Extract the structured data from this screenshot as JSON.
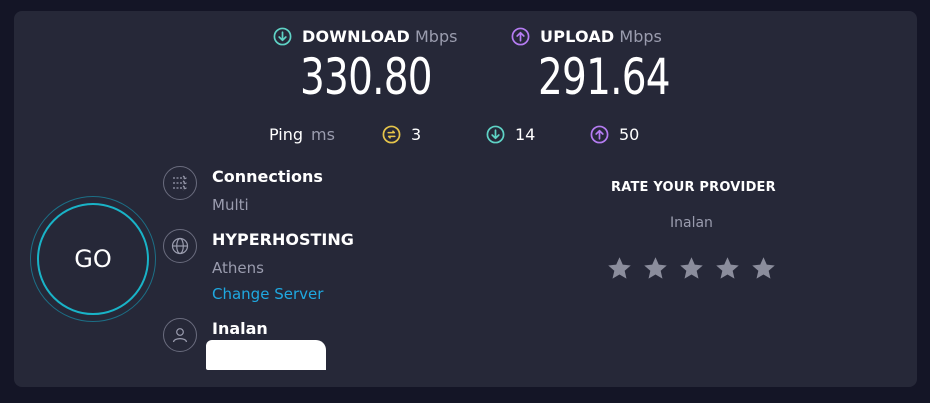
{
  "download": {
    "label": "DOWNLOAD",
    "unit": "Mbps",
    "value": "330.80"
  },
  "upload": {
    "label": "UPLOAD",
    "unit": "Mbps",
    "value": "291.64"
  },
  "ping": {
    "label": "Ping",
    "unit": "ms",
    "idle": "3",
    "download": "14",
    "upload": "50"
  },
  "go": {
    "label": "GO"
  },
  "connections": {
    "title": "Connections",
    "value": "Multi"
  },
  "server": {
    "title": "HYPERHOSTING",
    "location": "Athens",
    "change_label": "Change Server"
  },
  "provider": {
    "title": "Inalan"
  },
  "rating": {
    "title": "RATE YOUR PROVIDER",
    "provider": "Inalan",
    "stars": 5
  },
  "colors": {
    "download": "#5fd3c6",
    "upload": "#b57cf2",
    "idle": "#e6c54a",
    "go_ring": "#19b3c7",
    "link": "#1fa8e0"
  },
  "icons": {
    "download": "download-arrow-circle-icon",
    "upload": "upload-arrow-circle-icon",
    "idle": "ping-idle-icon",
    "connections": "connections-icon",
    "server": "globe-icon",
    "provider": "person-icon",
    "star": "star-icon"
  }
}
